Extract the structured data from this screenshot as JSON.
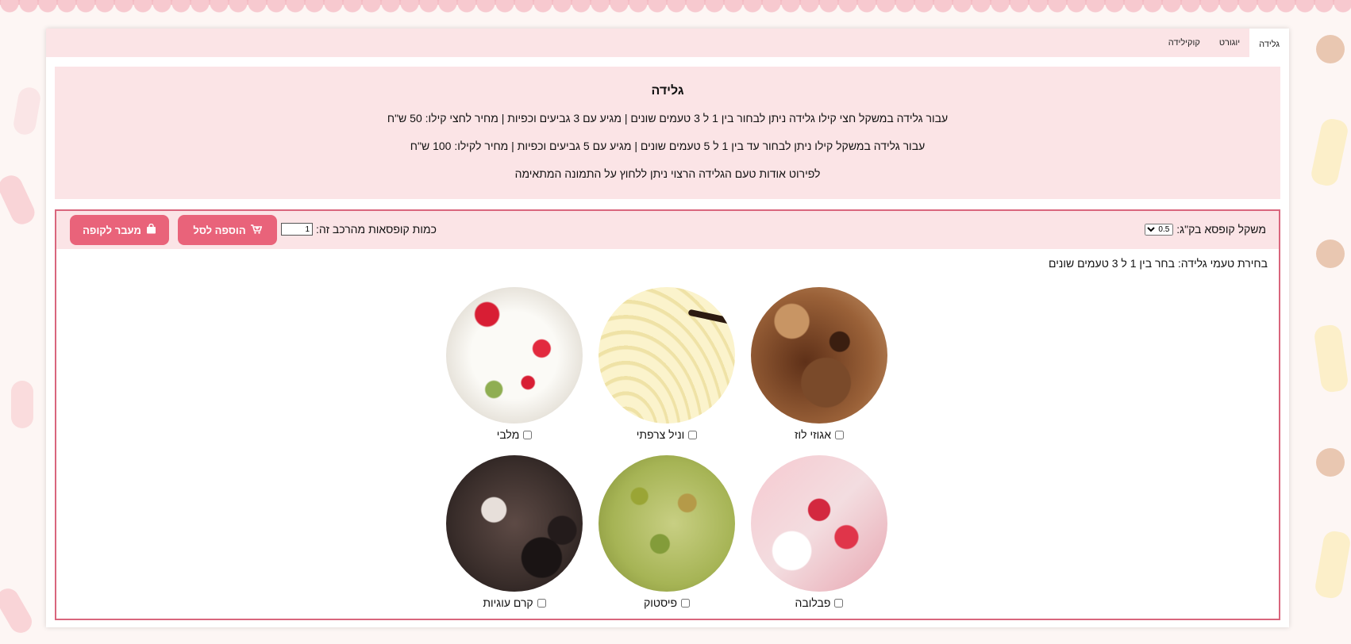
{
  "tabs": [
    {
      "label": "גלידה",
      "active": true
    },
    {
      "label": "יוגורט",
      "active": false
    },
    {
      "label": "קוקילידה",
      "active": false
    }
  ],
  "info": {
    "title": "גלידה",
    "line1": "עבור גלידה במשקל חצי קילו גלידה ניתן לבחור בין 1 ל 3 טעמים שונים | מגיע עם 3 גביעים וכפיות | מחיר לחצי קילו: 50 ש\"ח",
    "line2": "עבור גלידה במשקל קילו ניתן לבחור עד בין 1 ל 5 טעמים שונים | מגיע עם 5 גביעים וכפיות | מחיר לקילו: 100 ש\"ח",
    "line3": "לפירוט אודות טעם הגלידה הרצוי ניתן ללחוץ על התמונה המתאימה"
  },
  "toolbar": {
    "weight_label": "משקל קופסא בק\"ג:",
    "weight_value": "0.5",
    "qty_label": "כמות קופסאות מהרכב זה:",
    "qty_value": "1",
    "add_label": "הוספה לסל",
    "checkout_label": "מעבר לקופה"
  },
  "instructions": "בחירת טעמי גלידה: בחר בין 1 ל 3 טעמים שונים",
  "flavors": [
    {
      "name": "אגוזי לוז",
      "icon": "hazelnut-photo"
    },
    {
      "name": "וניל צרפתי",
      "icon": "vanilla-photo"
    },
    {
      "name": "מלבי",
      "icon": "malabi-photo"
    },
    {
      "name": "פבלובה",
      "icon": "pavlova-photo"
    },
    {
      "name": "פיסטוק",
      "icon": "pistachio-photo"
    },
    {
      "name": "קרם עוגיות",
      "icon": "cookies-cream-photo"
    }
  ],
  "colors": {
    "accent": "#e9637a",
    "panel": "#fbe4e6",
    "border": "#d9667d"
  }
}
